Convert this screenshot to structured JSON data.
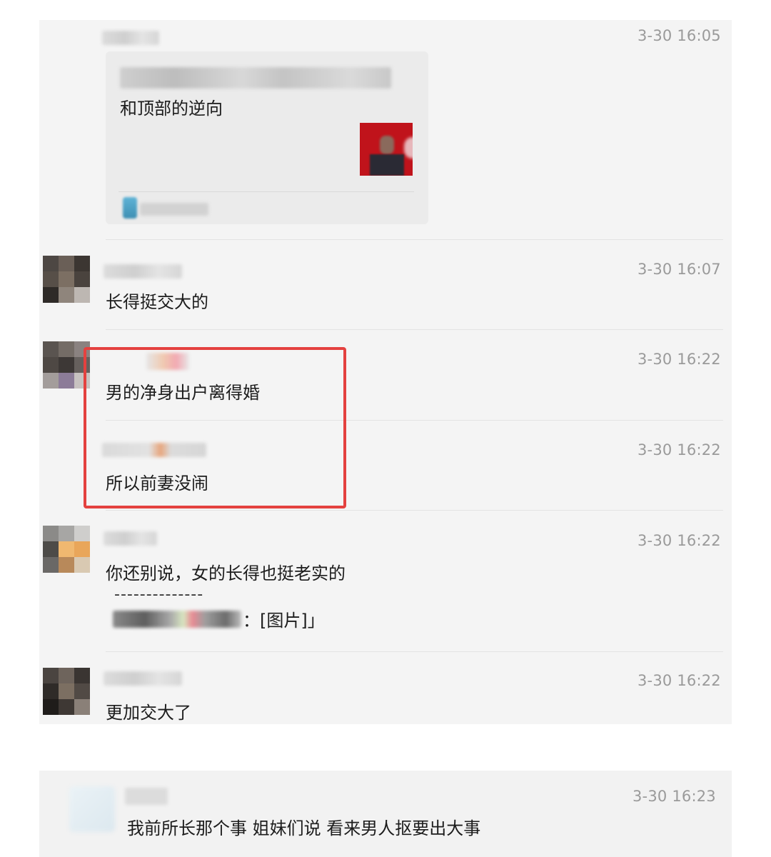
{
  "messages": [
    {
      "timestamp": "3-30 16:05",
      "card": {
        "text_tail": "和顶部的逆向"
      }
    },
    {
      "timestamp": "3-30 16:07",
      "text": "长得挺交大的"
    },
    {
      "timestamp": "3-30 16:22",
      "text": "男的净身出户离得婚"
    },
    {
      "timestamp": "3-30 16:22",
      "text": "所以前妻没闹"
    },
    {
      "timestamp": "3-30 16:22",
      "text": "你还别说，女的长得也挺老实的",
      "quote_divider": "--------------",
      "quote_suffix": "：[图片]」"
    },
    {
      "timestamp": "3-30 16:22",
      "text": "更加交大了"
    }
  ],
  "second_thread": {
    "timestamp": "3-30 16:23",
    "text": "我前所长那个事 姐妹们说  看来男人抠要出大事"
  },
  "colors": {
    "highlight_border": "#e4413f",
    "timestamp": "#9a9a9a",
    "panel_bg": "#f4f4f4"
  }
}
